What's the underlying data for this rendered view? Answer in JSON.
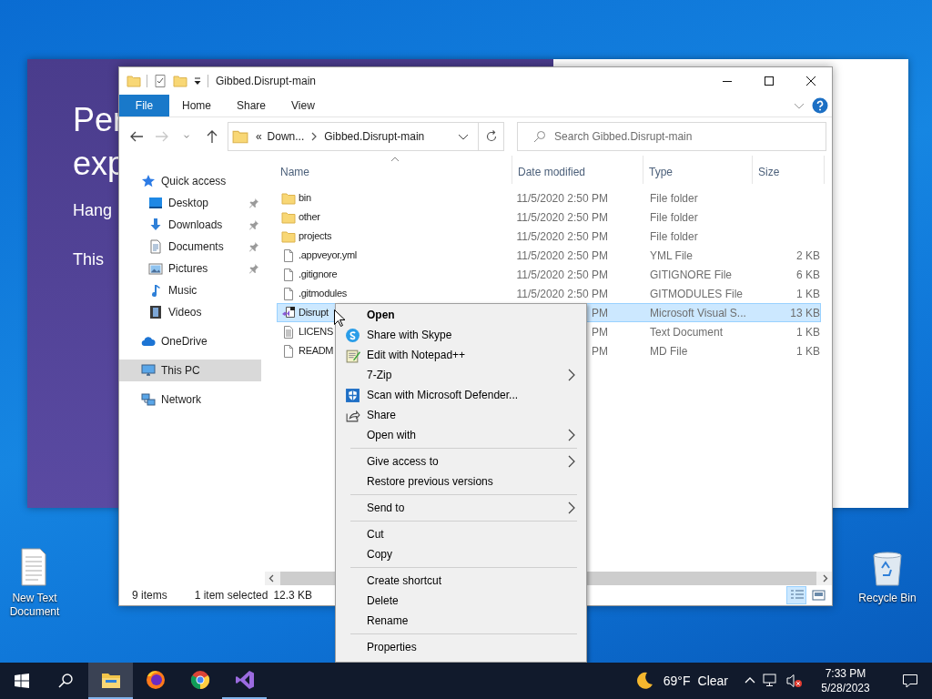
{
  "background_window": {
    "lines": [
      {
        "kind": "heading",
        "text": "Per"
      },
      {
        "kind": "heading",
        "text": "exp"
      },
      {
        "kind": "body",
        "text": "Hang"
      },
      {
        "kind": "body",
        "text": "This"
      }
    ]
  },
  "explorer": {
    "title": "Gibbed.Disrupt-main",
    "ribbon_tabs": [
      {
        "kind": "file",
        "label": "File"
      },
      {
        "kind": "tab",
        "label": "Home"
      },
      {
        "kind": "tab",
        "label": "Share"
      },
      {
        "kind": "tab",
        "label": "View"
      }
    ],
    "nav_buttons": [
      {
        "kind": "back",
        "disabled": false
      },
      {
        "kind": "forward",
        "disabled": true
      },
      {
        "kind": "recent",
        "disabled": false
      },
      {
        "kind": "up",
        "disabled": false
      }
    ],
    "address": {
      "overflow": "«",
      "crumbs": [
        "Down...",
        "Gibbed.Disrupt-main"
      ]
    },
    "search": {
      "placeholder": "Search Gibbed.Disrupt-main"
    },
    "nav_pane": [
      {
        "label": "Quick access",
        "kind": "star",
        "selected": false,
        "children": [
          {
            "label": "Desktop",
            "kind": "desktop",
            "pinned": true,
            "selected": false
          },
          {
            "label": "Downloads",
            "kind": "download",
            "pinned": true,
            "selected": false
          },
          {
            "label": "Documents",
            "kind": "documents",
            "pinned": true,
            "selected": false
          },
          {
            "label": "Pictures",
            "kind": "pictures",
            "pinned": true,
            "selected": false
          },
          {
            "label": "Music",
            "kind": "music",
            "pinned": false,
            "selected": false
          },
          {
            "label": "Videos",
            "kind": "videos",
            "pinned": false,
            "selected": false
          }
        ]
      },
      {
        "label": "OneDrive",
        "kind": "cloud",
        "selected": false
      },
      {
        "label": "This PC",
        "kind": "pc",
        "selected": true
      },
      {
        "label": "Network",
        "kind": "network",
        "selected": false
      }
    ],
    "columns": [
      {
        "label": "Name",
        "sorted": true
      },
      {
        "label": "Date modified",
        "sorted": false
      },
      {
        "label": "Type",
        "sorted": false
      },
      {
        "label": "Size",
        "sorted": false
      }
    ],
    "rows": [
      {
        "kind": "folder",
        "name": "bin",
        "date": "11/5/2020 2:50 PM",
        "type": "File folder",
        "selected": false
      },
      {
        "kind": "folder",
        "name": "other",
        "date": "11/5/2020 2:50 PM",
        "type": "File folder",
        "selected": false
      },
      {
        "kind": "folder",
        "name": "projects",
        "date": "11/5/2020 2:50 PM",
        "type": "File folder",
        "selected": false
      },
      {
        "kind": "file",
        "name": ".appveyor.yml",
        "date": "11/5/2020 2:50 PM",
        "type": "YML File",
        "size": "2 KB",
        "selected": false
      },
      {
        "kind": "file",
        "name": ".gitignore",
        "date": "11/5/2020 2:50 PM",
        "type": "GITIGNORE File",
        "size": "6 KB",
        "selected": false
      },
      {
        "kind": "file",
        "name": ".gitmodules",
        "date": "11/5/2020 2:50 PM",
        "type": "GITMODULES File",
        "size": "1 KB",
        "selected": false
      },
      {
        "kind": "vs",
        "name": "Disrupt",
        "date": "PM",
        "type": "Microsoft Visual S...",
        "size": "13 KB",
        "selected": true
      },
      {
        "kind": "text",
        "name": "LICENS",
        "date": "PM",
        "type": "Text Document",
        "size": "1 KB",
        "selected": false
      },
      {
        "kind": "file",
        "name": "READM",
        "date": "PM",
        "type": "MD File",
        "size": "1 KB",
        "selected": false
      }
    ],
    "status": {
      "count": "9 items",
      "selection": "1 item selected",
      "size": "12.3 KB"
    },
    "view_modes": [
      {
        "kind": "details",
        "selected": true
      },
      {
        "kind": "tiles",
        "selected": false
      }
    ]
  },
  "context_menu": [
    {
      "kind": "plain",
      "label": "Open",
      "default": true,
      "submenu": false
    },
    {
      "kind": "skype",
      "label": "Share with Skype",
      "default": false,
      "submenu": false
    },
    {
      "kind": "notepad",
      "label": "Edit with Notepad++",
      "default": false,
      "submenu": false
    },
    {
      "kind": "plain",
      "label": "7-Zip",
      "default": false,
      "submenu": true
    },
    {
      "kind": "defender",
      "label": "Scan with Microsoft Defender...",
      "default": false,
      "submenu": false
    },
    {
      "kind": "share",
      "label": "Share",
      "default": false,
      "submenu": false
    },
    {
      "kind": "plain",
      "label": "Open with",
      "default": false,
      "submenu": true
    },
    {
      "kind": "separator"
    },
    {
      "kind": "plain",
      "label": "Give access to",
      "default": false,
      "submenu": true
    },
    {
      "kind": "plain",
      "label": "Restore previous versions",
      "default": false,
      "submenu": false
    },
    {
      "kind": "separator"
    },
    {
      "kind": "plain",
      "label": "Send to",
      "default": false,
      "submenu": true
    },
    {
      "kind": "separator"
    },
    {
      "kind": "plain",
      "label": "Cut",
      "default": false,
      "submenu": false
    },
    {
      "kind": "plain",
      "label": "Copy",
      "default": false,
      "submenu": false
    },
    {
      "kind": "separator"
    },
    {
      "kind": "plain",
      "label": "Create shortcut",
      "default": false,
      "submenu": false
    },
    {
      "kind": "plain",
      "label": "Delete",
      "default": false,
      "submenu": false
    },
    {
      "kind": "plain",
      "label": "Rename",
      "default": false,
      "submenu": false
    },
    {
      "kind": "separator"
    },
    {
      "kind": "plain",
      "label": "Properties",
      "default": false,
      "submenu": false
    }
  ],
  "desktop_icons": [
    {
      "kind": "text",
      "label": "New Text Document"
    },
    {
      "kind": "recycle",
      "label": "Recycle Bin"
    }
  ],
  "taskbar": {
    "apps": [
      {
        "kind": "explorer",
        "active": true,
        "running": true
      },
      {
        "kind": "firefox",
        "active": false,
        "running": false
      },
      {
        "kind": "chrome",
        "active": false,
        "running": false
      },
      {
        "kind": "vs",
        "active": false,
        "running": true
      }
    ],
    "weather": {
      "temperature": "69°F",
      "condition": "Clear"
    },
    "time": "7:33 PM",
    "date": "5/28/2023"
  }
}
